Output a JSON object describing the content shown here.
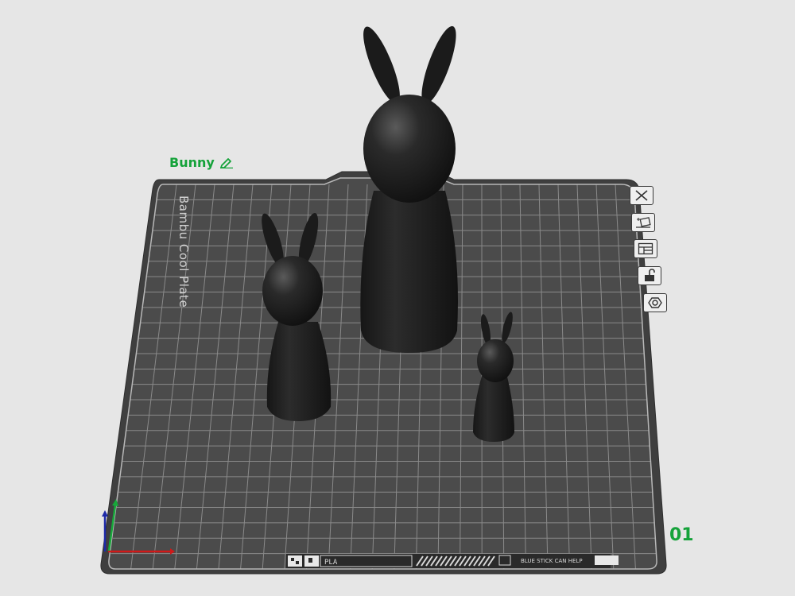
{
  "plate": {
    "name": "Bunny",
    "number": "01",
    "printed_label": "Bambu Cool Plate",
    "bottom_strip_code": "PLA",
    "bottom_strip_notice": "BLUE STICK CAN HELP"
  },
  "toolbar": {
    "icons": [
      "close-plate-icon",
      "auto-orient-icon",
      "arrange-icon",
      "lock-icon",
      "settings-icon"
    ]
  },
  "axes": {
    "x_color": "#d01919",
    "y_color": "#17a83a",
    "z_color": "#1e2aa8"
  },
  "colors": {
    "accent_green": "#15a23a",
    "plate": "#4b4b4b",
    "grid": "#8a8a8a",
    "model": "#1b1b1b",
    "background": "#e6e6e6"
  },
  "objects": [
    "bunny-large",
    "bunny-medium",
    "bunny-small"
  ]
}
